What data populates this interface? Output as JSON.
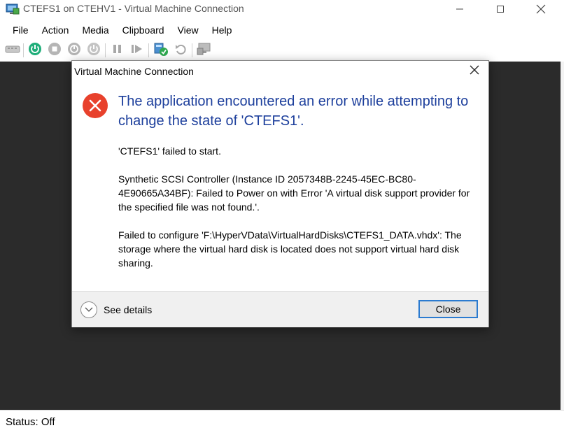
{
  "window": {
    "title": "CTEFS1 on CTEHV1 - Virtual Machine Connection",
    "icon": "vm-connection-icon",
    "controls": [
      "minimize-icon",
      "maximize-icon",
      "close-icon"
    ]
  },
  "menu": {
    "items": [
      "File",
      "Action",
      "Media",
      "Clipboard",
      "View",
      "Help"
    ]
  },
  "toolbar": {
    "buttons": [
      "ctrl-alt-del-icon",
      "start-icon",
      "turn-off-icon",
      "shut-down-icon",
      "save-icon",
      "pause-icon",
      "reset-icon",
      "checkpoint-icon",
      "revert-icon",
      "enhanced-session-icon"
    ]
  },
  "status": {
    "text": "Status: Off"
  },
  "dialog": {
    "title": "Virtual Machine Connection",
    "headline": "The application encountered an error while attempting to change the state of 'CTEFS1'.",
    "messages": [
      "'CTEFS1' failed to start.",
      "Synthetic SCSI Controller (Instance ID 2057348B-2245-45EC-BC80-4E90665A34BF): Failed to Power on with Error 'A virtual disk support provider for the specified file was not found.'.",
      "Failed to configure 'F:\\HyperVData\\VirtualHardDisks\\CTEFS1_DATA.vhdx': The storage where the virtual hard disk is located does not support virtual hard disk sharing."
    ],
    "details_label": "See details",
    "close_label": "Close",
    "icon": "error-icon",
    "colors": {
      "headline": "#1d3f9c",
      "error": "#e8412c",
      "focus_border": "#2b7bd0"
    }
  }
}
